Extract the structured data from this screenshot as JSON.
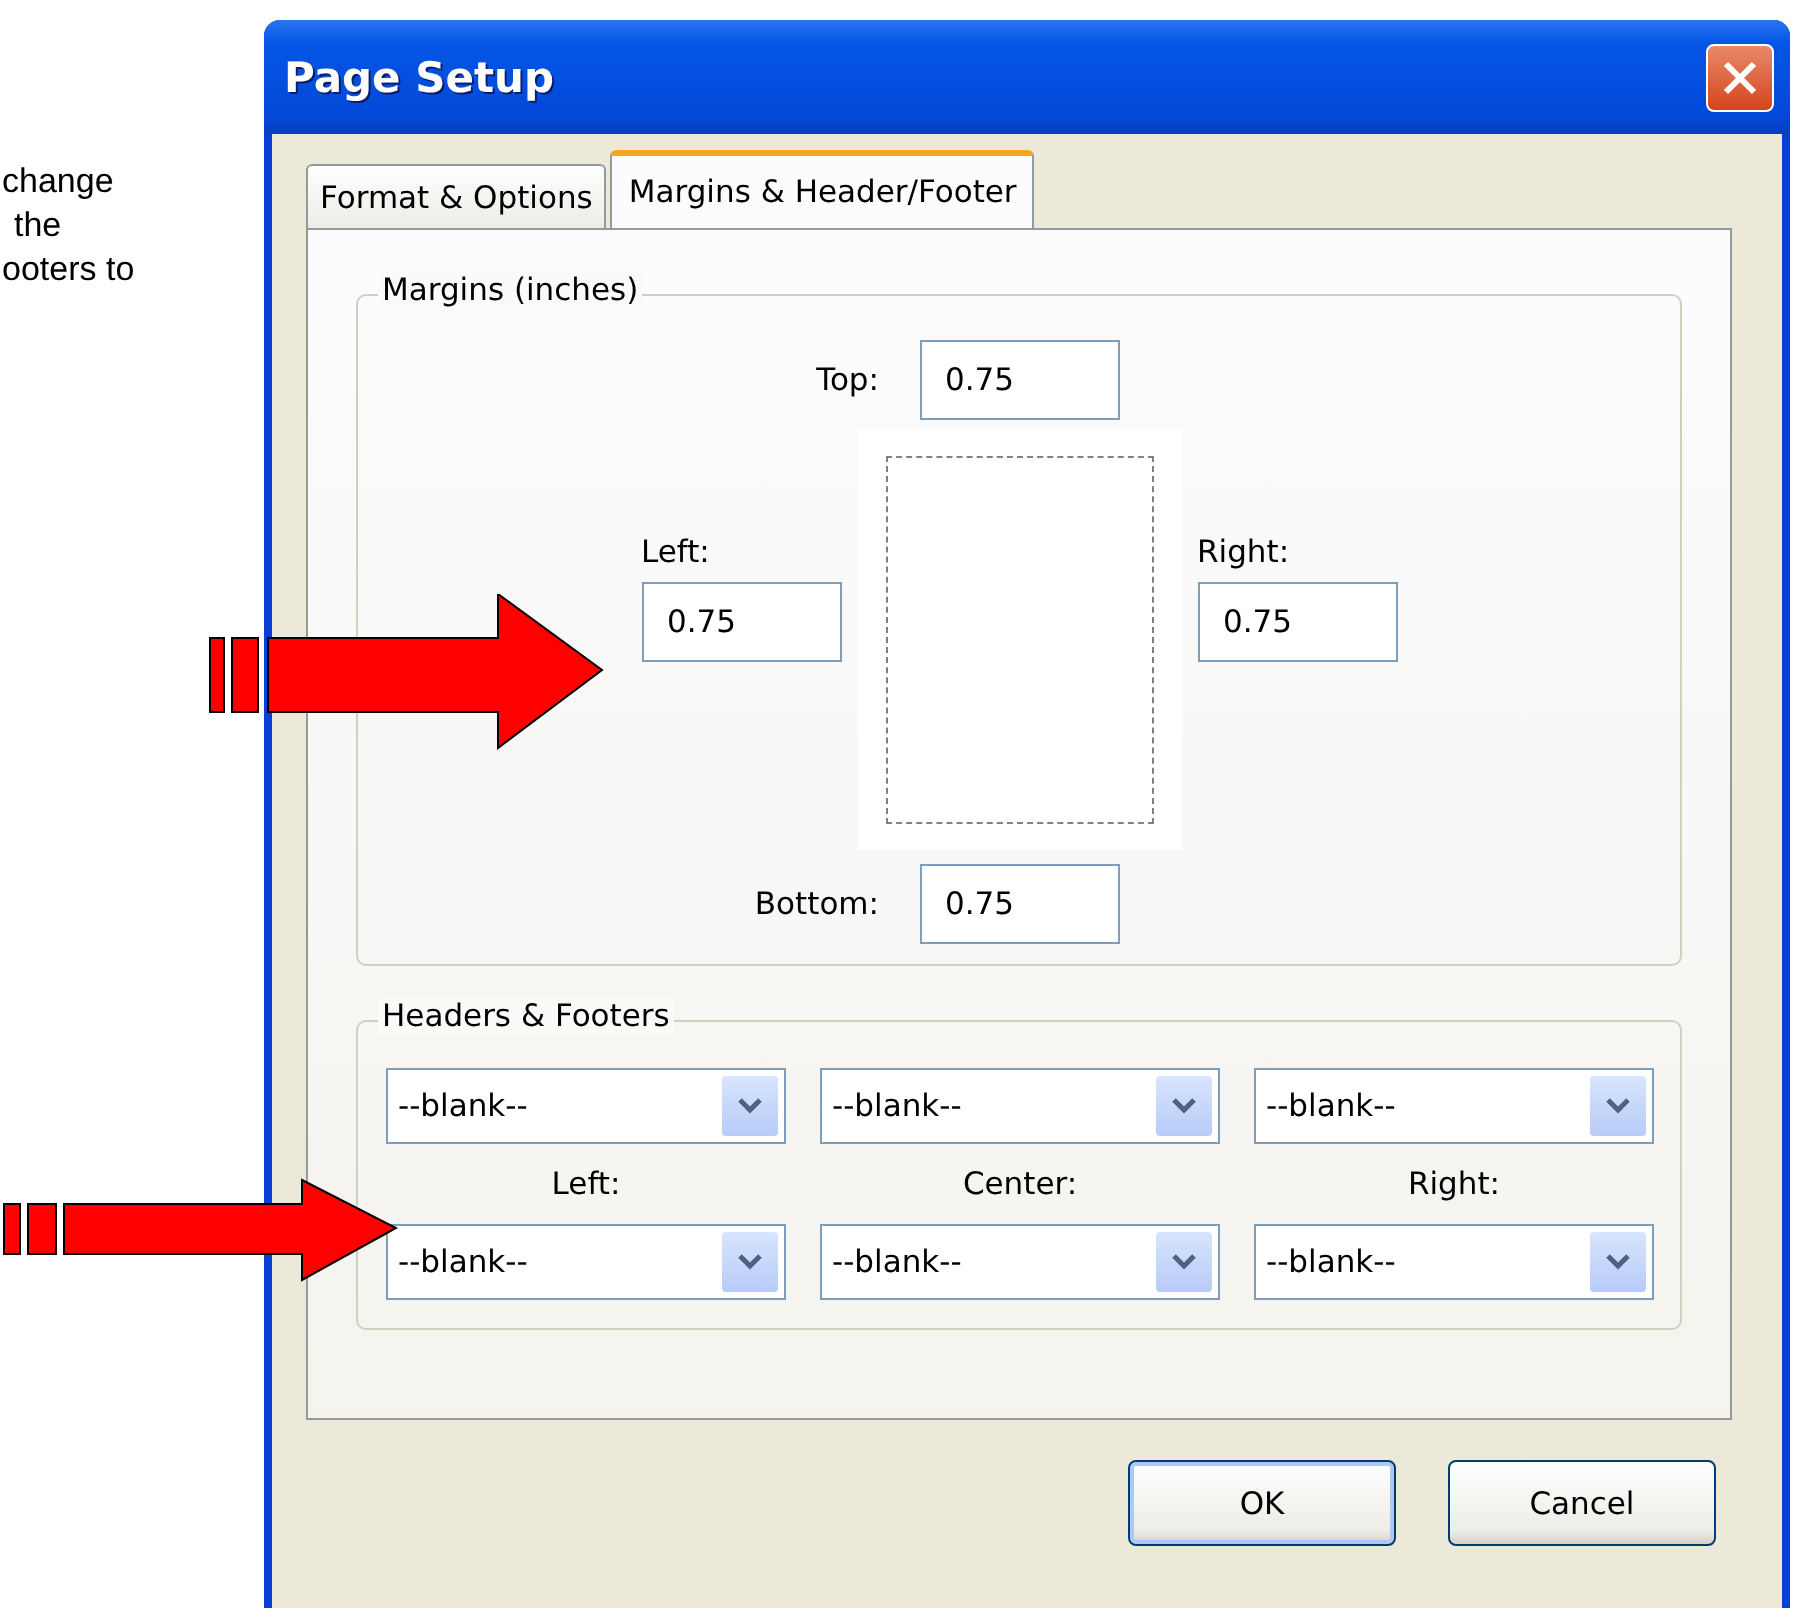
{
  "note": {
    "lines": [
      "change",
      "the",
      "ooters to"
    ]
  },
  "window": {
    "title": "Page Setup"
  },
  "tabs": [
    {
      "label": "Format & Options",
      "selected": false
    },
    {
      "label": "Margins & Header/Footer",
      "selected": true
    }
  ],
  "margins": {
    "title": "Margins (inches)",
    "top": {
      "label": "Top:",
      "value": "0.75"
    },
    "left": {
      "label": "Left:",
      "value": "0.75"
    },
    "right": {
      "label": "Right:",
      "value": "0.75"
    },
    "bottom": {
      "label": "Bottom:",
      "value": "0.75"
    }
  },
  "headers_footers": {
    "title": "Headers & Footers",
    "headers": [
      "--blank--",
      "--blank--",
      "--blank--"
    ],
    "labels": [
      "Left:",
      "Center:",
      "Right:"
    ],
    "footers": [
      "--blank--",
      "--blank--",
      "--blank--"
    ]
  },
  "buttons": [
    {
      "label": "OK",
      "default": true
    },
    {
      "label": "Cancel",
      "default": false
    }
  ]
}
